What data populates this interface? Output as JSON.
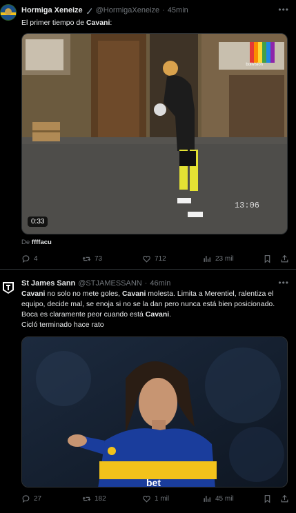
{
  "tweet1": {
    "display_name": "Hormiga Xeneize",
    "handle": "@HormigaXeneize",
    "separator": "·",
    "time": "45min",
    "text_prefix": "El primer tiempo de ",
    "text_bold": "Cavani",
    "text_suffix": ":",
    "video": {
      "duration": "0:33",
      "timestamp_overlay": "13:06",
      "channel_logo": "bolivision"
    },
    "source_prefix": "De ",
    "source_name": "ffffacu",
    "actions": {
      "replies": "4",
      "reposts": "73",
      "likes": "712",
      "views": "23 mil"
    }
  },
  "tweet2": {
    "display_name": "St James Sann",
    "handle": "@STJAMESSANN",
    "separator": "·",
    "time": "46min",
    "text_parts": [
      {
        "t": "Cavani",
        "b": true
      },
      {
        "t": " no solo no mete goles, ",
        "b": false
      },
      {
        "t": "Cavani",
        "b": true
      },
      {
        "t": " molesta. Limita a Merentiel, ralentiza el equipo, decide mal, se enoja si no se la dan pero nunca está bien posicionado. Boca es claramente peor cuando está ",
        "b": false
      },
      {
        "t": "Cavani",
        "b": true
      },
      {
        "t": ".",
        "b": false
      }
    ],
    "text_line2": "Cicló terminado hace rato",
    "image_text": "bet",
    "actions": {
      "replies": "27",
      "reposts": "182",
      "likes": "1 mil",
      "views": "45 mil"
    }
  },
  "colors": {
    "background": "#000000",
    "primary_text": "#e7e9ea",
    "secondary_text": "#71767b",
    "divider": "#2f3336",
    "boca_blue": "#1a3d9c",
    "boca_yellow": "#f2c21b"
  },
  "icons": [
    "reply-icon",
    "repost-icon",
    "like-icon",
    "views-icon",
    "bookmark-icon",
    "share-icon",
    "verified-badge-icon",
    "more-icon"
  ]
}
